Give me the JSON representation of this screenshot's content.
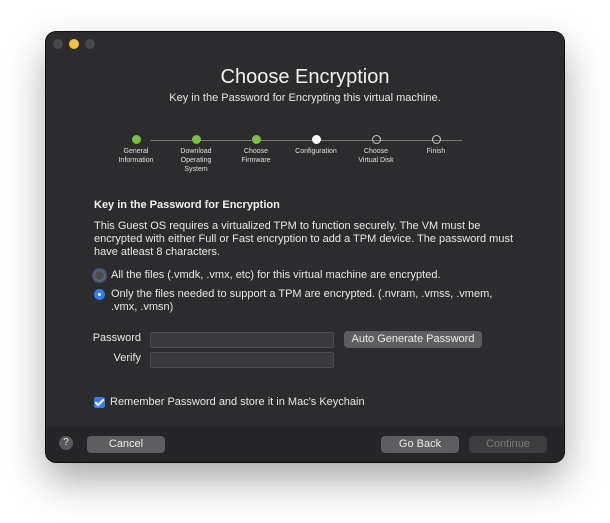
{
  "window": {
    "title": "Choose Encryption",
    "subtitle": "Key in the Password for Encrypting this virtual machine."
  },
  "steps": [
    {
      "label": "General\nInformation",
      "state": "done"
    },
    {
      "label": "Download\nOperating\nSystem",
      "state": "done"
    },
    {
      "label": "Choose\nFirmware",
      "state": "done"
    },
    {
      "label": "Configuration",
      "state": "current"
    },
    {
      "label": "Choose\nVirtual Disk",
      "state": "future"
    },
    {
      "label": "Finish",
      "state": "future"
    }
  ],
  "section": {
    "heading": "Key in the Password for Encryption",
    "description": "This Guest OS requires a virtualized TPM to function securely. The VM must be encrypted with either Full or Fast encryption to add a TPM device. The password must have atleast 8 characters."
  },
  "options": [
    {
      "label": "All the files (.vmdk, .vmx, etc) for this virtual machine are encrypted.",
      "selected": false
    },
    {
      "label": "Only the files needed to support a TPM are encrypted. (.nvram, .vmss, .vmem, .vmx, .vmsn)",
      "selected": true
    }
  ],
  "password": {
    "label": "Password",
    "value": ""
  },
  "verify": {
    "label": "Verify",
    "value": ""
  },
  "auto_generate_label": "Auto Generate Password",
  "remember": {
    "label": "Remember Password and store it in Mac's Keychain",
    "checked": true
  },
  "footer": {
    "help_label": "?",
    "cancel_label": "Cancel",
    "back_label": "Go Back",
    "continue_label": "Continue"
  },
  "colors": {
    "done": "#7ac143",
    "accent": "#2f7cf6",
    "window_bg": "#2c2c2e"
  }
}
